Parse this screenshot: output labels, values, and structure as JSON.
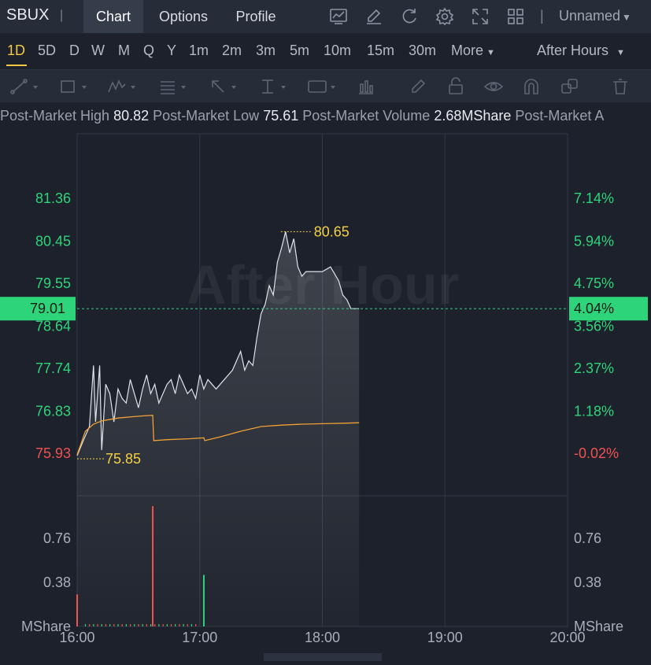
{
  "header": {
    "ticker": "SBUX",
    "separator": "|",
    "tabs": [
      {
        "label": "Chart",
        "active": true
      },
      {
        "label": "Options",
        "active": false
      },
      {
        "label": "Profile",
        "active": false
      }
    ],
    "icons": [
      "chart-indicator-icon",
      "edit-icon",
      "refresh-icon",
      "settings-icon",
      "fullscreen-icon",
      "layout-grid-icon"
    ],
    "layout_name": "Unnamed"
  },
  "intervals": {
    "items": [
      "1D",
      "5D",
      "D",
      "W",
      "M",
      "Q",
      "Y",
      "1m",
      "2m",
      "3m",
      "5m",
      "10m",
      "15m",
      "30m",
      "More"
    ],
    "active": "1D",
    "session": "After Hours"
  },
  "drawing_tools": [
    "trend-line-icon",
    "rectangle-icon",
    "wave-pattern-icon",
    "fibonacci-icon",
    "arrow-icon",
    "measure-icon",
    "text-annotation-icon",
    "indicator-icon",
    "pencil-icon",
    "lock-icon",
    "eye-icon",
    "magnet-icon",
    "clone-icon",
    "trash-icon"
  ],
  "stats": [
    {
      "label": "Post-Market High",
      "value": "80.82"
    },
    {
      "label": "Post-Market Low",
      "value": "75.61"
    },
    {
      "label": "Post-Market Volume",
      "value": "2.68MShare"
    },
    {
      "label": "Post-Market A",
      "value": ""
    }
  ],
  "colors": {
    "up": "#2ed47a",
    "down": "#f0524f",
    "price_line": "#dfe3ea",
    "avg_line": "#f0a037",
    "marker": "#f5d142",
    "grid": "#313847"
  },
  "chart_data": {
    "type": "line",
    "watermark": "After Hour",
    "x_ticks": [
      "16:00",
      "17:00",
      "18:00",
      "19:00",
      "20:00"
    ],
    "price_axis": {
      "left_ticks": [
        "81.36",
        "80.45",
        "79.55",
        "78.64",
        "77.74",
        "76.83",
        "75.93"
      ],
      "right_ticks": [
        "7.14%",
        "5.94%",
        "4.75%",
        "3.56%",
        "2.37%",
        "1.18%",
        "-0.02%"
      ],
      "tick_values": [
        81.36,
        80.45,
        79.55,
        78.64,
        77.74,
        76.83,
        75.93
      ]
    },
    "current_price": "79.01",
    "current_change": "4.04%",
    "high_marker": "80.65",
    "low_marker": "75.85",
    "volume_axis": {
      "ticks": [
        "0.76",
        "0.38"
      ],
      "unit": "MShare"
    },
    "series": [
      {
        "name": "price",
        "points": [
          [
            0,
            75.88
          ],
          [
            3,
            76.2
          ],
          [
            6,
            76.5
          ],
          [
            8,
            77.8
          ],
          [
            9,
            76.6
          ],
          [
            11,
            77.8
          ],
          [
            12,
            76.0
          ],
          [
            14,
            77.4
          ],
          [
            16,
            77.2
          ],
          [
            18,
            76.6
          ],
          [
            20,
            77.3
          ],
          [
            22,
            77.1
          ],
          [
            24,
            77.0
          ],
          [
            26,
            77.5
          ],
          [
            28,
            77.2
          ],
          [
            30,
            76.9
          ],
          [
            32,
            77.3
          ],
          [
            34,
            77.6
          ],
          [
            36,
            77.2
          ],
          [
            38,
            77.4
          ],
          [
            40,
            77.0
          ],
          [
            42,
            77.2
          ],
          [
            44,
            77.4
          ],
          [
            46,
            77.5
          ],
          [
            48,
            77.2
          ],
          [
            50,
            77.6
          ],
          [
            52,
            77.4
          ],
          [
            54,
            77.2
          ],
          [
            56,
            77.3
          ],
          [
            58,
            77.1
          ],
          [
            60,
            77.6
          ],
          [
            62,
            77.3
          ],
          [
            64,
            77.5
          ],
          [
            66,
            77.4
          ],
          [
            68,
            77.3
          ],
          [
            70,
            77.4
          ],
          [
            72,
            77.5
          ],
          [
            74,
            77.6
          ],
          [
            76,
            77.7
          ],
          [
            78,
            77.9
          ],
          [
            80,
            78.1
          ],
          [
            82,
            77.7
          ],
          [
            84,
            77.9
          ],
          [
            86,
            77.8
          ],
          [
            88,
            78.4
          ],
          [
            90,
            78.9
          ],
          [
            92,
            79.1
          ],
          [
            94,
            79.5
          ],
          [
            96,
            79.3
          ],
          [
            98,
            80.0
          ],
          [
            100,
            80.3
          ],
          [
            102,
            80.65
          ],
          [
            104,
            80.2
          ],
          [
            106,
            80.5
          ],
          [
            108,
            79.9
          ],
          [
            110,
            79.7
          ],
          [
            112,
            79.8
          ],
          [
            116,
            79.8
          ],
          [
            120,
            79.8
          ],
          [
            124,
            79.9
          ],
          [
            128,
            79.6
          ],
          [
            130,
            79.3
          ],
          [
            132,
            79.2
          ],
          [
            134,
            79.01
          ],
          [
            138,
            79.01
          ]
        ]
      },
      {
        "name": "average",
        "points": [
          [
            0,
            75.9
          ],
          [
            4,
            76.4
          ],
          [
            8,
            76.55
          ],
          [
            12,
            76.62
          ],
          [
            20,
            76.68
          ],
          [
            30,
            76.72
          ],
          [
            37,
            76.74
          ],
          [
            37.5,
            76.2
          ],
          [
            44,
            76.22
          ],
          [
            55,
            76.24
          ],
          [
            62,
            76.26
          ],
          [
            62.5,
            76.2
          ],
          [
            70,
            76.28
          ],
          [
            80,
            76.4
          ],
          [
            90,
            76.5
          ],
          [
            100,
            76.53
          ],
          [
            110,
            76.55
          ],
          [
            120,
            76.56
          ],
          [
            130,
            76.57
          ],
          [
            138,
            76.58
          ]
        ]
      }
    ],
    "volume": [
      {
        "x": 0,
        "v": 0.28,
        "dir": "down"
      },
      {
        "x": 37,
        "v": 1.05,
        "dir": "down"
      },
      {
        "x": 62,
        "v": 0.45,
        "dir": "up"
      }
    ],
    "time_range_minutes": [
      0,
      240
    ]
  }
}
